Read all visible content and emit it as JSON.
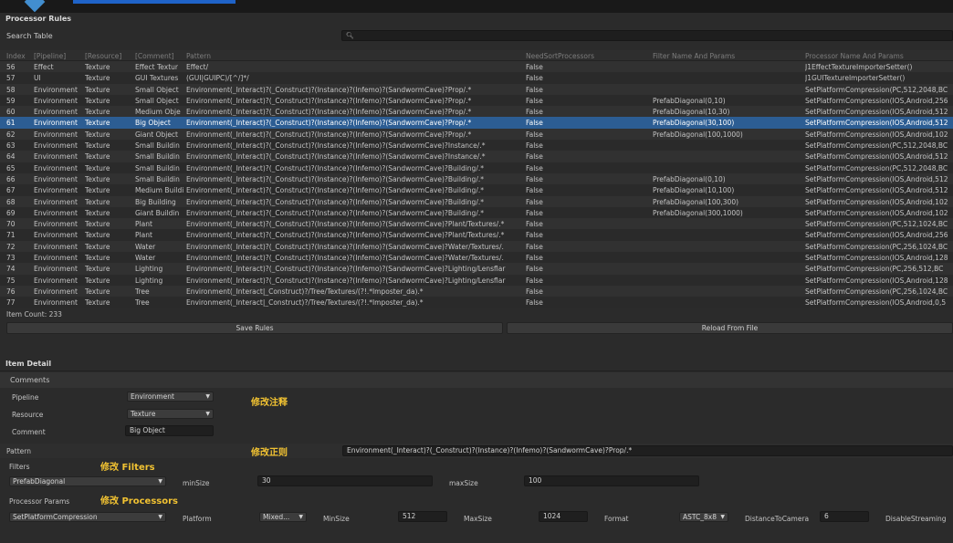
{
  "panel_title": "Processor Rules",
  "search": {
    "label": "Search Table",
    "placeholder": ""
  },
  "columns": [
    "Index",
    "[Pipeline]",
    "[Resource]",
    "[Comment]",
    "Pattern",
    "NeedSortProcessors",
    "Filter Name And Params",
    "Processor Name And Params"
  ],
  "rows": [
    [
      "56",
      "Effect",
      "Texture",
      "Effect Textur",
      "Effect/",
      "False",
      "",
      "J1EffectTextureImporterSetter()"
    ],
    [
      "57",
      "UI",
      "Texture",
      "GUI Textures",
      "(GUI|GUIPC)/[^/]*/",
      "False",
      "",
      "J1GUITextureImporterSetter()"
    ],
    [
      "58",
      "Environment",
      "Texture",
      "Small Object",
      "Environment(_Interact)?(_Construct)?(Instance)?(Infemo)?(SandwormCave)?Prop/.*",
      "False",
      "",
      "SetPlatformCompression(PC,512,2048,BC"
    ],
    [
      "59",
      "Environment",
      "Texture",
      "Small Object",
      "Environment(_Interact)?(_Construct)?(Instance)?(Infemo)?(SandwormCave)?Prop/.*",
      "False",
      "PrefabDiagonal(0,10)",
      "SetPlatformCompression(IOS,Android,256"
    ],
    [
      "60",
      "Environment",
      "Texture",
      "Medium Obje",
      "Environment(_Interact)?(_Construct)?(Instance)?(Infemo)?(SandwormCave)?Prop/.*",
      "False",
      "PrefabDiagonal(10,30)",
      "SetPlatformCompression(IOS,Android,512"
    ],
    [
      "61",
      "Environment",
      "Texture",
      "Big Object",
      "Environment(_Interact)?(_Construct)?(Instance)?(Infemo)?(SandwormCave)?Prop/.*",
      "False",
      "PrefabDiagonal(30,100)",
      "SetPlatformCompression(IOS,Android,512"
    ],
    [
      "62",
      "Environment",
      "Texture",
      "Giant Object",
      "Environment(_Interact)?(_Construct)?(Instance)?(Infemo)?(SandwormCave)?Prop/.*",
      "False",
      "PrefabDiagonal(100,1000)",
      "SetPlatformCompression(IOS,Android,102"
    ],
    [
      "63",
      "Environment",
      "Texture",
      "Small Buildin",
      "Environment(_Interact)?(_Construct)?(Instance)?(Infemo)?(SandwormCave)?Instance/.*",
      "False",
      "",
      "SetPlatformCompression(PC,512,2048,BC"
    ],
    [
      "64",
      "Environment",
      "Texture",
      "Small Buildin",
      "Environment(_Interact)?(_Construct)?(Instance)?(Infemo)?(SandwormCave)?Instance/.*",
      "False",
      "",
      "SetPlatformCompression(IOS,Android,512"
    ],
    [
      "65",
      "Environment",
      "Texture",
      "Small Buildin",
      "Environment(_Interact)?(_Construct)?(Instance)?(Infemo)?(SandwormCave)?Building/.*",
      "False",
      "",
      "SetPlatformCompression(PC,512,2048,BC"
    ],
    [
      "66",
      "Environment",
      "Texture",
      "Small Buildin",
      "Environment(_Interact)?(_Construct)?(Instance)?(Infemo)?(SandwormCave)?Building/.*",
      "False",
      "PrefabDiagonal(0,10)",
      "SetPlatformCompression(IOS,Android,512"
    ],
    [
      "67",
      "Environment",
      "Texture",
      "Medium Buildi",
      "Environment(_Interact)?(_Construct)?(Instance)?(Infemo)?(SandwormCave)?Building/.*",
      "False",
      "PrefabDiagonal(10,100)",
      "SetPlatformCompression(IOS,Android,512"
    ],
    [
      "68",
      "Environment",
      "Texture",
      "Big Building",
      "Environment(_Interact)?(_Construct)?(Instance)?(Infemo)?(SandwormCave)?Building/.*",
      "False",
      "PrefabDiagonal(100,300)",
      "SetPlatformCompression(IOS,Android,102"
    ],
    [
      "69",
      "Environment",
      "Texture",
      "Giant Buildin",
      "Environment(_Interact)?(_Construct)?(Instance)?(Infemo)?(SandwormCave)?Building/.*",
      "False",
      "PrefabDiagonal(300,1000)",
      "SetPlatformCompression(IOS,Android,102"
    ],
    [
      "70",
      "Environment",
      "Texture",
      "Plant",
      "Environment(_Interact)?(_Construct)?(Instance)?(Infemo)?(SandwormCave)?Plant/Textures/.*",
      "False",
      "",
      "SetPlatformCompression(PC,512,1024,BC"
    ],
    [
      "71",
      "Environment",
      "Texture",
      "Plant",
      "Environment(_Interact)?(_Construct)?(Instance)?(Infemo)?(SandwormCave)?Plant/Textures/.*",
      "False",
      "",
      "SetPlatformCompression(IOS,Android,256"
    ],
    [
      "72",
      "Environment",
      "Texture",
      "Water",
      "Environment(_Interact)?(_Construct)?(Instance)?(Infemo)?(SandwormCave)?Water/Textures/.",
      "False",
      "",
      "SetPlatformCompression(PC,256,1024,BC"
    ],
    [
      "73",
      "Environment",
      "Texture",
      "Water",
      "Environment(_Interact)?(_Construct)?(Instance)?(Infemo)?(SandwormCave)?Water/Textures/.",
      "False",
      "",
      "SetPlatformCompression(IOS,Android,128"
    ],
    [
      "74",
      "Environment",
      "Texture",
      "Lighting",
      "Environment(_Interact)?(_Construct)?(Instance)?(Infemo)?(SandwormCave)?Lighting/Lensflar",
      "False",
      "",
      "SetPlatformCompression(PC,256,512,BC"
    ],
    [
      "75",
      "Environment",
      "Texture",
      "Lighting",
      "Environment(_Interact)?(_Construct)?(Instance)?(Infemo)?(SandwormCave)?Lighting/Lensflar",
      "False",
      "",
      "SetPlatformCompression(IOS,Android,128"
    ],
    [
      "76",
      "Environment",
      "Texture",
      "Tree",
      "Environment(_Interact|_Construct)?/Tree/Textures/(?!.*Imposter_da).*",
      "False",
      "",
      "SetPlatformCompression(PC,256,1024,BC"
    ],
    [
      "77",
      "Environment",
      "Texture",
      "Tree",
      "Environment(_Interact|_Construct)?/Tree/Textures/(?!.*Imposter_da).*",
      "False",
      "",
      "SetPlatformCompression(IOS,Android,0,5"
    ]
  ],
  "selected_row_index": "61",
  "item_count": "Item Count: 233",
  "buttons": {
    "save": "Save Rules",
    "reload": "Reload From File"
  },
  "detail": {
    "title": "Item Detail",
    "comments_label": "Comments",
    "pipeline_label": "Pipeline",
    "pipeline_value": "Environment",
    "resource_label": "Resource",
    "resource_value": "Texture",
    "comment_label": "Comment",
    "comment_value": "Big Object",
    "pattern_label": "Pattern",
    "pattern_value": "Environment(_Interact)?(_Construct)?(Instance)?(Infemo)?(SandwormCave)?Prop/.*",
    "filters_label": "Filters",
    "filter_value": "PrefabDiagonal",
    "min_size_label": "minSize",
    "min_size_value": "30",
    "max_size_label": "maxSize",
    "max_size_value": "100",
    "processor_params_label": "Processor Params",
    "processor_value": "SetPlatformCompression",
    "platform_label": "Platform",
    "platform_value": "Mixed...",
    "min_size2_label": "MinSize",
    "min_size2_value": "512",
    "max_size2_label": "MaxSize",
    "max_size2_value": "1024",
    "format_label": "Format",
    "format_value": "ASTC_8x8",
    "distance_label": "DistanceToCamera",
    "distance_value": "6",
    "disable_streaming_label": "DisableStreaming"
  },
  "annotations": {
    "comment": "修改注释",
    "pattern": "修改正则",
    "filters": "修改 Filters",
    "processors": "修改 Processors"
  },
  "colors": {
    "selection": "#2c5d93",
    "annotation": "#f1c232",
    "background": "#2b2b2b"
  }
}
